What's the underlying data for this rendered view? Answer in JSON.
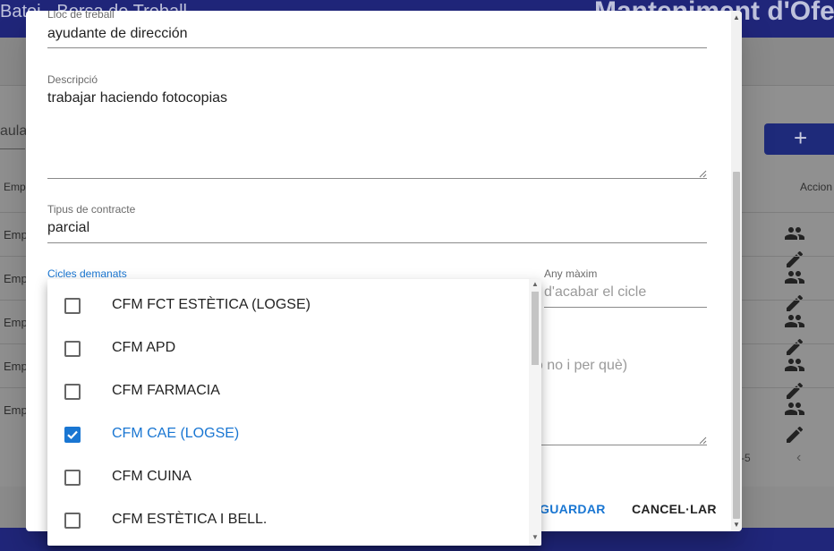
{
  "background": {
    "app_title": "Batoi - Borsa de Treball",
    "page_title": "Manteniment d'Ofer",
    "search_partial": "aula",
    "add_symbol": "+",
    "columns": {
      "empresa": "Emp",
      "accions": "Accion"
    },
    "rows": [
      "Emp",
      "Emp",
      "Emp",
      "Emp",
      "Emp"
    ],
    "pagination_partial": "-5",
    "prev_symbol": "‹"
  },
  "dialog": {
    "lloc": {
      "label": "Lloc de treball",
      "value": "ayudante de dirección"
    },
    "descripcio": {
      "label": "Descripció",
      "value": "trabajar haciendo fotocopias"
    },
    "tipus": {
      "label": "Tipus de contracte",
      "value": "parcial"
    },
    "cicles": {
      "label": "Cicles demanats"
    },
    "any_maxim": {
      "label": "Any màxim",
      "placeholder": "d'acabar el cicle"
    },
    "obscured_hint": "t o no i per què)",
    "save_label": "GUARDAR",
    "cancel_label": "CANCEL·LAR"
  },
  "cycles_menu": {
    "items": [
      {
        "label": "CFM FCT ESTÈTICA (LOGSE)",
        "checked": false
      },
      {
        "label": "CFM APD",
        "checked": false
      },
      {
        "label": "CFM FARMACIA",
        "checked": false
      },
      {
        "label": "CFM CAE (LOGSE)",
        "checked": true
      },
      {
        "label": "CFM CUINA",
        "checked": false
      },
      {
        "label": "CFM ESTÈTICA I BELL.",
        "checked": false
      }
    ]
  },
  "colors": {
    "primary": "#1976d2",
    "header": "#20267a"
  }
}
